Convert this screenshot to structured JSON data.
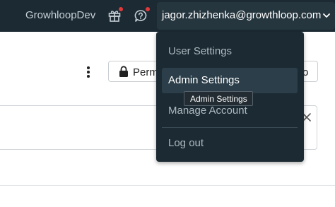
{
  "header": {
    "org_name": "GrowhloopDev",
    "user_email": "jagor.zhizhenka@growthloop.com",
    "icons": [
      "gift-icon",
      "help-bubble-icon",
      "chevron-down-icon"
    ],
    "colors": {
      "bar": "#1c2a33",
      "notification_dot": "#e23a3a"
    }
  },
  "page": {
    "permission_button_label": "Perm",
    "right_button_fragment": "o"
  },
  "user_menu": {
    "items": [
      {
        "label": "User Settings"
      },
      {
        "label": "Admin Settings"
      },
      {
        "label": "Manage Account"
      },
      {
        "label": "Log out"
      }
    ],
    "tooltip": "Admin Settings"
  }
}
